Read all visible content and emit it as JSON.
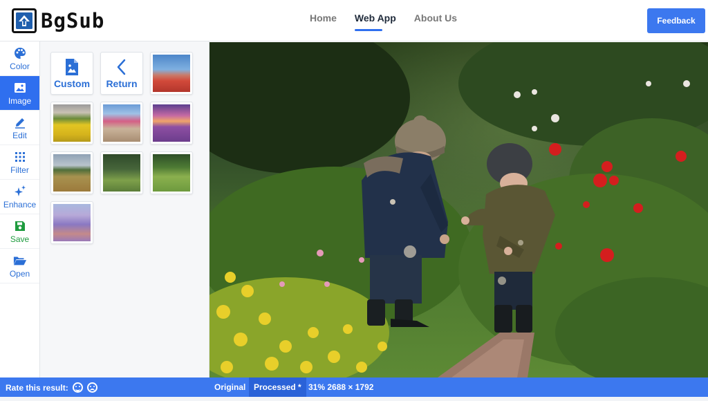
{
  "app": {
    "logo_text": "BgSub"
  },
  "nav": {
    "items": [
      {
        "label": "Home",
        "active": false
      },
      {
        "label": "Web App",
        "active": true
      },
      {
        "label": "About Us",
        "active": false
      }
    ]
  },
  "header": {
    "feedback_label": "Feedback"
  },
  "tools": [
    {
      "label": "Color",
      "icon": "palette-icon"
    },
    {
      "label": "Image",
      "icon": "image-icon",
      "active": true
    },
    {
      "label": "Edit",
      "icon": "pencil-icon"
    },
    {
      "label": "Filter",
      "icon": "grid-dots-icon"
    },
    {
      "label": "Enhance",
      "icon": "sparkle-icon"
    },
    {
      "label": "Save",
      "icon": "floppy-disk-icon"
    },
    {
      "label": "Open",
      "icon": "folder-open-icon"
    }
  ],
  "panel": {
    "custom_label": "Custom",
    "return_label": "Return",
    "backgrounds": [
      "tulip-field",
      "sunflower-field",
      "pink-flower-path",
      "purple-sunset-field",
      "grain-field",
      "forest-path",
      "green-field-path",
      "lavender-field"
    ]
  },
  "status": {
    "rate_label": "Rate this result:",
    "original_label": "Original",
    "processed_label": "Processed *",
    "info": "31% 2688 × 1792"
  },
  "colors": {
    "accent": "#3c78ef",
    "save": "#1e9b3e",
    "icon": "#2b6fd6"
  }
}
